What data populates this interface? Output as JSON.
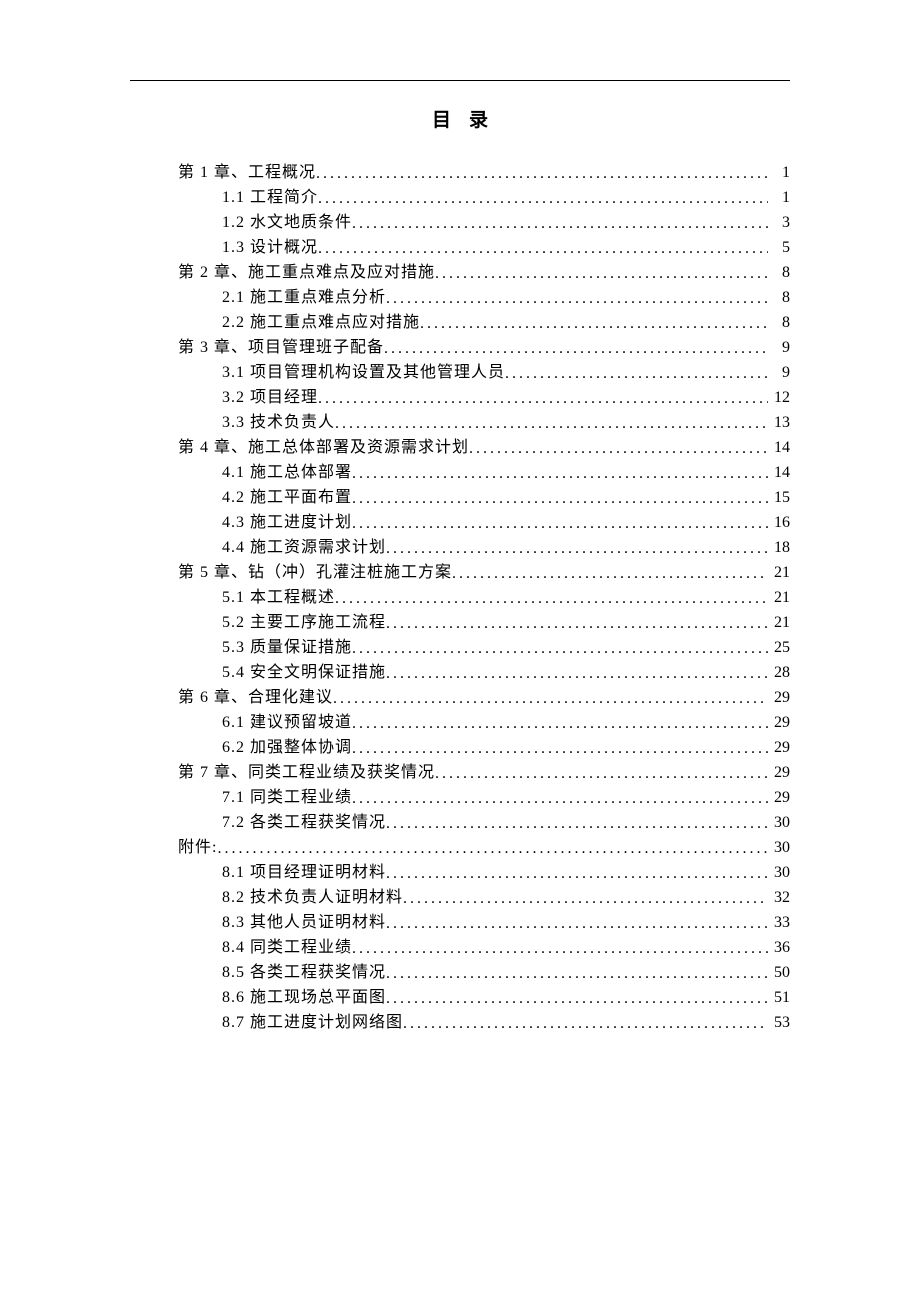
{
  "title": "目录",
  "toc": [
    {
      "level": 0,
      "label": "第 1 章、工程概况",
      "page": "1"
    },
    {
      "level": 1,
      "label": "1.1 工程简介",
      "page": "1"
    },
    {
      "level": 1,
      "label": "1.2 水文地质条件",
      "page": "3"
    },
    {
      "level": 1,
      "label": "1.3 设计概况",
      "page": "5"
    },
    {
      "level": 0,
      "label": "第 2 章、施工重点难点及应对措施",
      "page": "8"
    },
    {
      "level": 1,
      "label": "2.1 施工重点难点分析",
      "page": "8"
    },
    {
      "level": 1,
      "label": "2.2 施工重点难点应对措施",
      "page": "8"
    },
    {
      "level": 0,
      "label": "第 3 章、项目管理班子配备",
      "page": "9"
    },
    {
      "level": 1,
      "label": "3.1 项目管理机构设置及其他管理人员",
      "page": "9"
    },
    {
      "level": 1,
      "label": "3.2 项目经理",
      "page": "12"
    },
    {
      "level": 1,
      "label": "3.3 技术负责人",
      "page": "13"
    },
    {
      "level": 0,
      "label": "第 4 章、施工总体部署及资源需求计划",
      "page": "14"
    },
    {
      "level": 1,
      "label": "4.1 施工总体部署",
      "page": "14"
    },
    {
      "level": 1,
      "label": "4.2 施工平面布置",
      "page": "15"
    },
    {
      "level": 1,
      "label": "4.3 施工进度计划",
      "page": "16"
    },
    {
      "level": 1,
      "label": "4.4 施工资源需求计划",
      "page": "18"
    },
    {
      "level": 0,
      "label": "第 5 章、钻（冲）孔灌注桩施工方案",
      "page": "21"
    },
    {
      "level": 1,
      "label": "5.1 本工程概述",
      "page": "21"
    },
    {
      "level": 1,
      "label": "5.2 主要工序施工流程",
      "page": "21"
    },
    {
      "level": 1,
      "label": "5.3 质量保证措施",
      "page": "25"
    },
    {
      "level": 1,
      "label": "5.4 安全文明保证措施",
      "page": "28"
    },
    {
      "level": 0,
      "label": "第 6 章、合理化建议",
      "page": "29"
    },
    {
      "level": 1,
      "label": "6.1 建议预留坡道",
      "page": "29"
    },
    {
      "level": 1,
      "label": "6.2 加强整体协调",
      "page": "29"
    },
    {
      "level": 0,
      "label": "第 7 章、同类工程业绩及获奖情况",
      "page": "29"
    },
    {
      "level": 1,
      "label": "7.1 同类工程业绩",
      "page": "29"
    },
    {
      "level": 1,
      "label": "7.2 各类工程获奖情况",
      "page": "30"
    },
    {
      "level": 0,
      "label": "附件:",
      "page": "30"
    },
    {
      "level": 1,
      "label": "8.1 项目经理证明材料",
      "page": "30"
    },
    {
      "level": 1,
      "label": "8.2 技术负责人证明材料",
      "page": "32"
    },
    {
      "level": 1,
      "label": "8.3 其他人员证明材料",
      "page": "33"
    },
    {
      "level": 1,
      "label": "8.4 同类工程业绩",
      "page": "36"
    },
    {
      "level": 1,
      "label": "8.5 各类工程获奖情况",
      "page": "50"
    },
    {
      "level": 1,
      "label": "8.6 施工现场总平面图",
      "page": "51"
    },
    {
      "level": 1,
      "label": "8.7 施工进度计划网络图",
      "page": "53"
    }
  ]
}
